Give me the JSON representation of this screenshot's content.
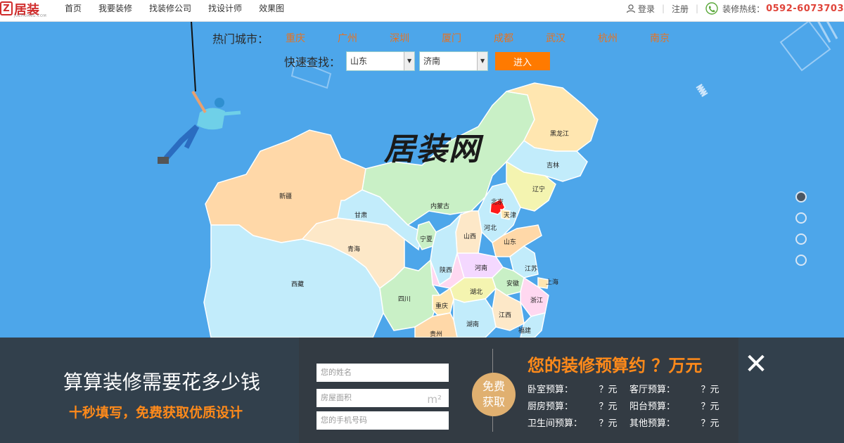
{
  "header": {
    "logo_text": "居装",
    "logo_letter": "Z",
    "logo_sub": "JUZHUANG.COM",
    "nav": [
      "首页",
      "我要装修",
      "找装修公司",
      "找设计师",
      "效果图"
    ],
    "login": "登录",
    "register": "注册",
    "hotline_label": "装修热线：",
    "hotline_number": "0592-6073703"
  },
  "search": {
    "hot_label": "热门城市：",
    "hot_cities": [
      "重庆",
      "广州",
      "深圳",
      "厦门",
      "成都",
      "武汉",
      "杭州",
      "南京"
    ],
    "quick_label": "快速查找：",
    "province_select": "山东",
    "city_select": "济南",
    "go_button": "进入"
  },
  "map": {
    "brand_text": "居装网",
    "provinces": [
      "黑龙江",
      "吉林",
      "辽宁",
      "内蒙古",
      "北京",
      "天津",
      "河北",
      "山东",
      "新疆",
      "甘肃",
      "宁夏",
      "山西",
      "青海",
      "陕西",
      "河南",
      "江苏",
      "上海",
      "西藏",
      "安徽",
      "湖北",
      "浙江",
      "四川",
      "重庆",
      "江西",
      "福建",
      "湖南",
      "贵州"
    ],
    "highlight_color": "#ff0000"
  },
  "carousel": {
    "active_index": 0,
    "count": 4
  },
  "banner": {
    "title": "算算装修需要花多少钱",
    "subtitle": "十秒填写，免费获取优质设计",
    "name_placeholder": "您的姓名",
    "area_placeholder": "房屋面积",
    "area_unit": "m²",
    "phone_placeholder": "您的手机号码",
    "circle_line1": "免费",
    "circle_line2": "获取",
    "estimate_title": "您的装修预算约 ？万元",
    "items": [
      {
        "label": "卧室预算：",
        "value": "？元"
      },
      {
        "label": "客厅预算：",
        "value": "？元"
      },
      {
        "label": "厨房预算：",
        "value": "？元"
      },
      {
        "label": "阳台预算：",
        "value": "？元"
      },
      {
        "label": "卫生间预算：",
        "value": "？元"
      },
      {
        "label": "其他预算：",
        "value": "？元"
      }
    ],
    "close_icon": "close-icon"
  },
  "colors": {
    "accent": "#ff7a00",
    "background": "#4da6ea",
    "banner": "#303840"
  }
}
